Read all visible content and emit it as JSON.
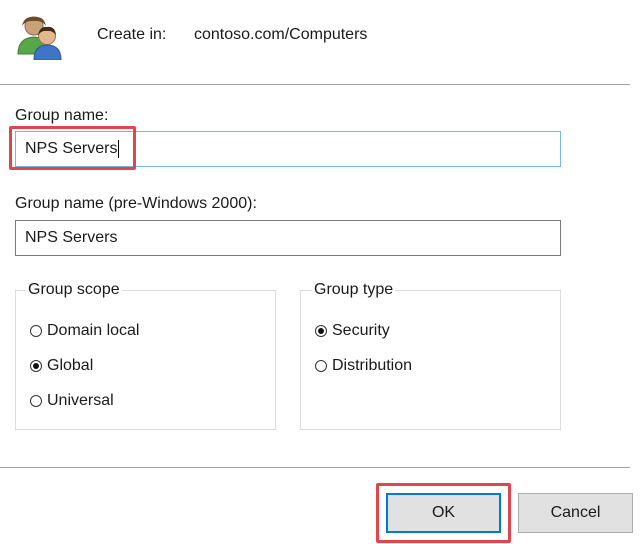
{
  "header": {
    "icon": "group-users-icon",
    "create_in_label": "Create in:",
    "create_in_path": "contoso.com/Computers"
  },
  "form": {
    "group_name_label": "Group name:",
    "group_name_value": "NPS Servers",
    "pre2000_label": "Group name (pre-Windows 2000):",
    "pre2000_value": "NPS Servers"
  },
  "scope": {
    "title": "Group scope",
    "options": [
      {
        "label": "Domain local",
        "checked": false
      },
      {
        "label": "Global",
        "checked": true
      },
      {
        "label": "Universal",
        "checked": false
      }
    ]
  },
  "type": {
    "title": "Group type",
    "options": [
      {
        "label": "Security",
        "checked": true
      },
      {
        "label": "Distribution",
        "checked": false
      }
    ]
  },
  "buttons": {
    "ok_label": "OK",
    "cancel_label": "Cancel"
  },
  "colors": {
    "highlight": "#e0454b",
    "focus_border": "#79b7e4",
    "default_button_border": "#0078d7"
  }
}
